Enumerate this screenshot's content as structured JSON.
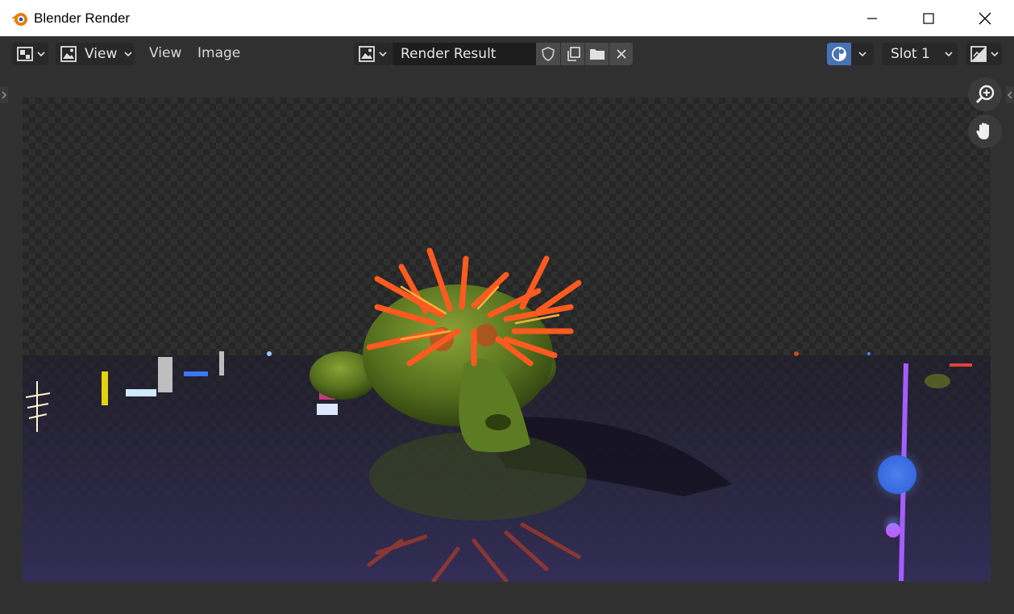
{
  "window": {
    "title": "Blender Render"
  },
  "header": {
    "view_mode_label": "View",
    "menus": [
      "View",
      "Image"
    ],
    "image_name": "Render Result",
    "slot": "Slot 1"
  },
  "colors": {
    "accent": "#4772b3",
    "header_bg": "#303030",
    "button_bg": "#282828",
    "titlebar_bg": "#ffffff",
    "blender_orange": "#e87d0d"
  }
}
